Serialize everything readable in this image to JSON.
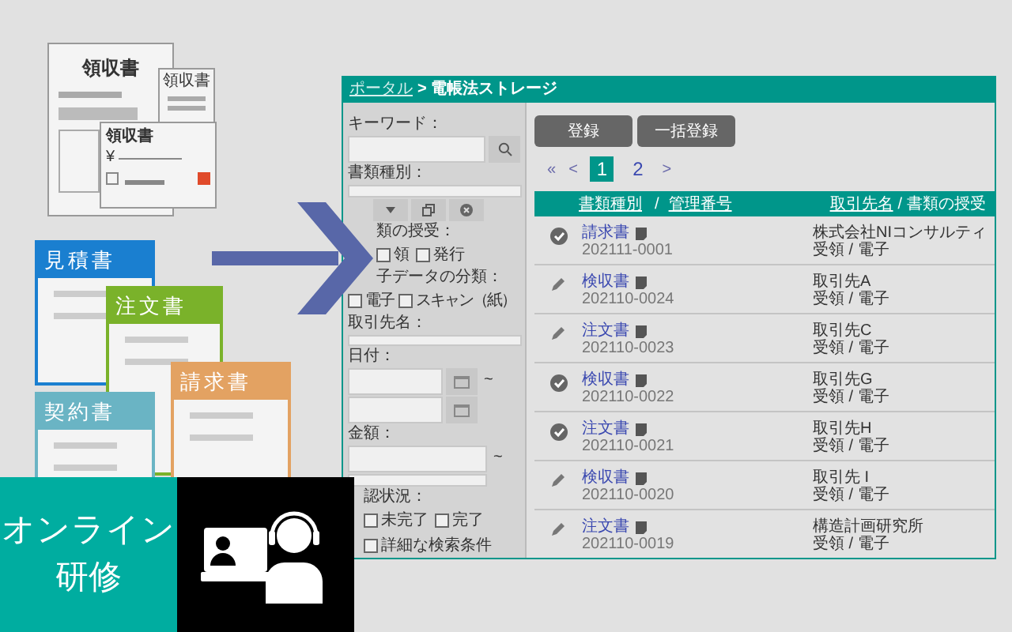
{
  "illustration": {
    "receipts": [
      {
        "title": "領収書"
      },
      {
        "title": "領収書"
      },
      {
        "title": "領収書",
        "amount_mark": "¥"
      }
    ],
    "documents": [
      {
        "title": "見積書",
        "color": "#1a7fd0"
      },
      {
        "title": "注文書",
        "color": "#7ab22a"
      },
      {
        "title": "契約書",
        "color": "#6ab4c4"
      },
      {
        "title": "請求書",
        "color": "#e3a262"
      }
    ]
  },
  "window": {
    "breadcrumb": {
      "link": "ポータル",
      "current": "> 電帳法ストレージ"
    },
    "search": {
      "keyword_label": "キーワード：",
      "type_label": "書類種別：",
      "exchange_label": "類の授受：",
      "exchange_options": [
        {
          "label": "領",
          "checked": false
        },
        {
          "label": "発行",
          "checked": false
        }
      ],
      "class_label": "子データの分類：",
      "class_options": [
        {
          "label": "電子",
          "checked": false
        },
        {
          "label": "スキャン（紙）",
          "checked": false
        }
      ],
      "partner_label": "取引先名：",
      "date_label": "日付：",
      "range_mark": "~",
      "amount_label": "金額：",
      "amount_range_mark": "~",
      "status_label": "認状況：",
      "status_options": [
        {
          "label": "未完了",
          "checked": false
        },
        {
          "label": "完了",
          "checked": false
        }
      ],
      "advanced": {
        "label": "詳細な検索条件",
        "checked": false
      }
    },
    "buttons": [
      "登録",
      "一括登録"
    ],
    "pagination": [
      {
        "label": "«",
        "kind": "nav"
      },
      {
        "label": "<",
        "kind": "nav"
      },
      {
        "label": "1",
        "kind": "page",
        "selected": true
      },
      {
        "label": "2",
        "kind": "page",
        "selected": false
      },
      {
        "label": ">",
        "kind": "nav"
      }
    ],
    "table": {
      "columns": [
        "書類種別",
        "/",
        "管理番号",
        "取引先名",
        "/ 書類の授受"
      ],
      "rows": [
        {
          "kind": "confirmed",
          "type": "請求書",
          "number": "202111-0001",
          "partner": "株式会社NIコンサルティ",
          "exchange": "受領 / 電子"
        },
        {
          "kind": "editing",
          "type": "検収書",
          "number": "202110-0024",
          "partner": "取引先A",
          "exchange": "受領 / 電子"
        },
        {
          "kind": "editing",
          "type": "注文書",
          "number": "202110-0023",
          "partner": "取引先C",
          "exchange": "受領 / 電子"
        },
        {
          "kind": "confirmed",
          "type": "検収書",
          "number": "202110-0022",
          "partner": "取引先G",
          "exchange": "受領 / 電子"
        },
        {
          "kind": "confirmed",
          "type": "注文書",
          "number": "202110-0021",
          "partner": "取引先H",
          "exchange": "受領 / 電子"
        },
        {
          "kind": "editing",
          "type": "検収書",
          "number": "202110-0020",
          "partner": "取引先 I",
          "exchange": "受領 / 電子"
        },
        {
          "kind": "editing",
          "type": "注文書",
          "number": "202110-0019",
          "partner": "構造計画研究所",
          "exchange": "受領 / 電子"
        }
      ]
    }
  },
  "banner": {
    "lines": [
      "オンライン",
      "研修"
    ]
  }
}
